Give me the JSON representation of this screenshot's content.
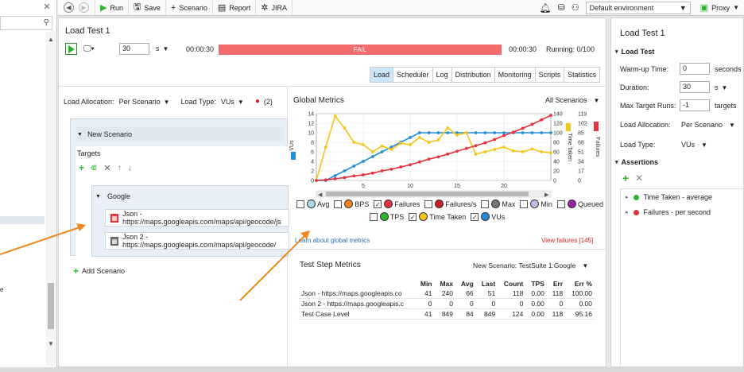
{
  "left_panel": {
    "partial_text": "e"
  },
  "toolbar": {
    "run": "Run",
    "save": "Save",
    "scenario": "Scenario",
    "report": "Report",
    "jira": "JIRA",
    "environment": "Default environment",
    "proxy": "Proxy"
  },
  "main": {
    "title": "Load Test 1",
    "duration_value": "30",
    "duration_unit": "s",
    "elapsed": "00:00:30",
    "status": "FAIL",
    "total": "00:00:30",
    "running": "Running: 0/100",
    "tabs": [
      {
        "label": "Load",
        "active": true
      },
      {
        "label": "Scheduler"
      },
      {
        "label": "Log"
      },
      {
        "label": "Distribution"
      },
      {
        "label": "Monitoring"
      },
      {
        "label": "Scripts"
      },
      {
        "label": "Statistics"
      }
    ]
  },
  "scenario_panel": {
    "load_allocation_label": "Load Allocation:",
    "load_allocation": "Per Scenario",
    "load_type_label": "Load Type:",
    "load_type": "VUs",
    "error_count": "(2)",
    "scenario_name": "New Scenario",
    "targets_label": "Targets",
    "target_name": "Google",
    "requests": [
      "Json - https://maps.googleapis.com/maps/api/geocode/js",
      "Json 2 - https://maps.googleapis.com/maps/api/geocode/"
    ],
    "add_scenario": "Add Scenario"
  },
  "global_metrics": {
    "title": "Global Metrics",
    "filter": "All Scenarios",
    "learn_link": "Learn about global metrics",
    "view_failures": "View failures [145]",
    "checkboxes": [
      {
        "label": "Avg",
        "checked": false,
        "color": "#a9d8ea"
      },
      {
        "label": "BPS",
        "checked": false,
        "color": "#f0861d"
      },
      {
        "label": "Failures",
        "checked": true,
        "color": "#e8303a"
      },
      {
        "label": "Failures/s",
        "checked": false,
        "color": "#c81e1e"
      },
      {
        "label": "Max",
        "checked": false,
        "color": "#777777"
      },
      {
        "label": "Min",
        "checked": false,
        "color": "#c9b8e8"
      },
      {
        "label": "Queued",
        "checked": false,
        "color": "#9b1ea8"
      },
      {
        "label": "TPS",
        "checked": false,
        "color": "#2bb52b"
      },
      {
        "label": "Time Taken",
        "checked": true,
        "color": "#f5c518"
      },
      {
        "label": "VUs",
        "checked": true,
        "color": "#1e8fd8"
      }
    ]
  },
  "chart_data": {
    "type": "line",
    "x_ticks": [
      "5",
      "10",
      "15",
      "20"
    ],
    "xlim": [
      0,
      25
    ],
    "axes": {
      "vus": {
        "label": "VUs",
        "ticks": [
          "0",
          "2",
          "4",
          "6",
          "8",
          "10",
          "12",
          "14"
        ]
      },
      "time_taken": {
        "label": "Time Taken",
        "ticks": [
          "0",
          "20",
          "40",
          "60",
          "80",
          "100",
          "120",
          "140"
        ]
      },
      "failures": {
        "label": "Failures",
        "ticks": [
          "0",
          "17",
          "34",
          "51",
          "68",
          "85",
          "102",
          "119"
        ]
      }
    },
    "series": [
      {
        "name": "VUs",
        "color": "#1e8fd8",
        "axis": "vus",
        "x": [
          0,
          1,
          2,
          3,
          4,
          5,
          6,
          7,
          8,
          9,
          10,
          11,
          12,
          13,
          14,
          15,
          16,
          17,
          18,
          19,
          20,
          21,
          22,
          23,
          24,
          25
        ],
        "y": [
          0,
          0,
          1,
          2,
          3,
          4,
          5,
          6,
          7,
          8,
          9,
          10,
          10,
          10,
          10,
          10,
          10,
          10,
          10,
          10,
          10,
          10,
          10,
          10,
          10,
          10
        ]
      },
      {
        "name": "Time Taken",
        "color": "#f5c518",
        "axis": "time_taken",
        "x": [
          0,
          1,
          2,
          3,
          4,
          5,
          6,
          7,
          8,
          9,
          10,
          11,
          12,
          13,
          14,
          15,
          16,
          17,
          18,
          19,
          20,
          21,
          22,
          23,
          24,
          25
        ],
        "y": [
          0,
          70,
          135,
          110,
          80,
          75,
          60,
          72,
          65,
          78,
          75,
          90,
          80,
          85,
          110,
          95,
          100,
          55,
          60,
          65,
          70,
          62,
          60,
          66,
          60,
          58
        ]
      },
      {
        "name": "Failures",
        "color": "#e8303a",
        "axis": "failures",
        "x": [
          0,
          1,
          2,
          3,
          4,
          5,
          6,
          7,
          8,
          9,
          10,
          11,
          12,
          13,
          14,
          15,
          16,
          17,
          18,
          19,
          20,
          21,
          22,
          23,
          24,
          25
        ],
        "y": [
          0,
          1,
          3,
          5,
          8,
          10,
          13,
          17,
          20,
          24,
          28,
          33,
          38,
          42,
          47,
          52,
          57,
          62,
          67,
          73,
          80,
          86,
          93,
          100,
          108,
          116
        ]
      }
    ]
  },
  "step_metrics": {
    "title": "Test Step Metrics",
    "filter": "New Scenario: TestSuite 1:Google",
    "columns": [
      "",
      "Min",
      "Max",
      "Avg",
      "Last",
      "Count",
      "TPS",
      "Err",
      "Err %"
    ],
    "rows": [
      [
        "Json - https://maps.googleapis.co",
        "41",
        "240",
        "66",
        "51",
        "118",
        "0.00",
        "118",
        "100.00"
      ],
      [
        "Json 2 - https://maps.googleapis.c",
        "0",
        "0",
        "0",
        "0",
        "0",
        "0.00",
        "0",
        "0.00"
      ],
      [
        "Test Case Level",
        "41",
        "849",
        "84",
        "849",
        "124",
        "0.00",
        "118",
        "95.16"
      ]
    ]
  },
  "right_panel": {
    "title": "Load Test 1",
    "section": "Load Test",
    "warmup_label": "Warm-up Time:",
    "warmup_value": "0",
    "warmup_unit": "seconds",
    "duration_label": "Duration:",
    "duration_value": "30",
    "duration_unit": "s",
    "max_target_label": "Max Target Runs:",
    "max_target_value": "-1",
    "max_target_unit": "targets",
    "alloc_label": "Load Allocation:",
    "alloc_value": "Per Scenario",
    "type_label": "Load Type:",
    "type_value": "VUs",
    "assertions_label": "Assertions",
    "assertions": [
      {
        "label": "Time Taken - average",
        "color": "#2bb52b"
      },
      {
        "label": "Failures - per second",
        "color": "#e8303a"
      }
    ]
  }
}
